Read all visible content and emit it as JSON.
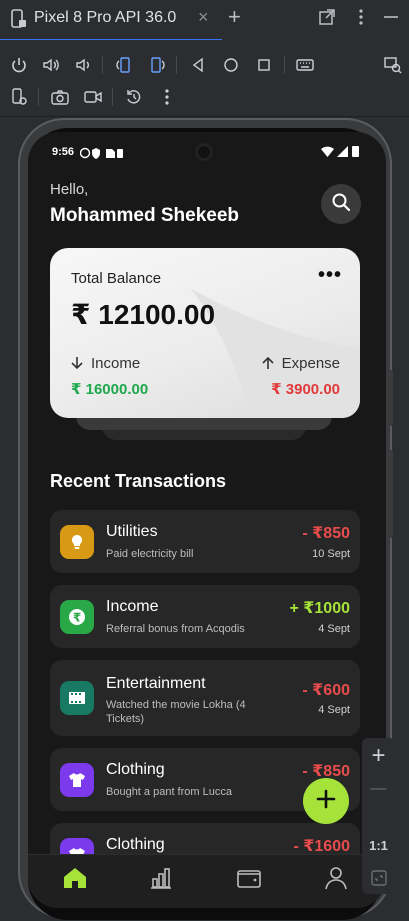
{
  "ide": {
    "tab_title": "Pixel 8 Pro API 36.0",
    "tab_close": "×",
    "tab_add": "+",
    "window_actions": [
      "open-external-icon",
      "more-vert-icon",
      "minimize-icon"
    ],
    "toolbar_row1": [
      "power-icon",
      "volume-up-icon",
      "volume-down-icon",
      "rotate-left-icon",
      "rotate-right-icon",
      "back-icon",
      "home-icon",
      "overview-icon",
      "keyboard-icon",
      "display-mode-icon"
    ],
    "toolbar_row2": [
      "device-settings-icon",
      "camera-icon",
      "screen-record-icon",
      "snapshot-icon",
      "more-vert-icon"
    ],
    "side_controls": {
      "zoom_in": "+",
      "zoom_out": "—",
      "ratio": "1:1"
    }
  },
  "status_bar": {
    "time": "9:56"
  },
  "header": {
    "greeting": "Hello,",
    "username": "Mohammed Shekeeb"
  },
  "balance_card": {
    "title": "Total Balance",
    "menu": "•••",
    "amount": "₹ 12100.00",
    "income_label": "Income",
    "income_value": "₹ 16000.00",
    "expense_label": "Expense",
    "expense_value": "₹ 3900.00"
  },
  "recent": {
    "title": "Recent Transactions",
    "items": [
      {
        "name": "Utilities",
        "desc": "Paid electricity bill",
        "amount": "- ₹850",
        "date": "10 Sept",
        "icon": "lightbulb-icon",
        "icon_color": "#d89a14",
        "amount_color": "#e84c4c"
      },
      {
        "name": "Income",
        "desc": "Referral bonus from Acqodis",
        "amount": "+ ₹1000",
        "date": "4 Sept",
        "icon": "rupee-icon",
        "icon_color": "#29a847",
        "amount_color": "#a6e33a"
      },
      {
        "name": "Entertainment",
        "desc": "Watched the movie Lokha (4 Tickets)",
        "amount": "- ₹600",
        "date": "4 Sept",
        "icon": "film-icon",
        "icon_color": "#187a63",
        "amount_color": "#e84c4c"
      },
      {
        "name": "Clothing",
        "desc": "Bought a pant from Lucca",
        "amount": "- ₹850",
        "date": "",
        "icon": "shirt-icon",
        "icon_color": "#7c3aed",
        "amount_color": "#e84c4c"
      },
      {
        "name": "Clothing",
        "desc": "",
        "amount": "- ₹1600",
        "date": "",
        "icon": "shirt-icon",
        "icon_color": "#7c3aed",
        "amount_color": "#e84c4c"
      }
    ]
  },
  "fab": {
    "icon": "plus-icon",
    "color": "#a6e33a"
  },
  "bottom_nav": [
    {
      "name": "home",
      "icon": "home-icon",
      "active": true
    },
    {
      "name": "stats",
      "icon": "bar-chart-icon",
      "active": false
    },
    {
      "name": "wallet",
      "icon": "wallet-icon",
      "active": false
    },
    {
      "name": "profile",
      "icon": "profile-icon",
      "active": false
    }
  ]
}
